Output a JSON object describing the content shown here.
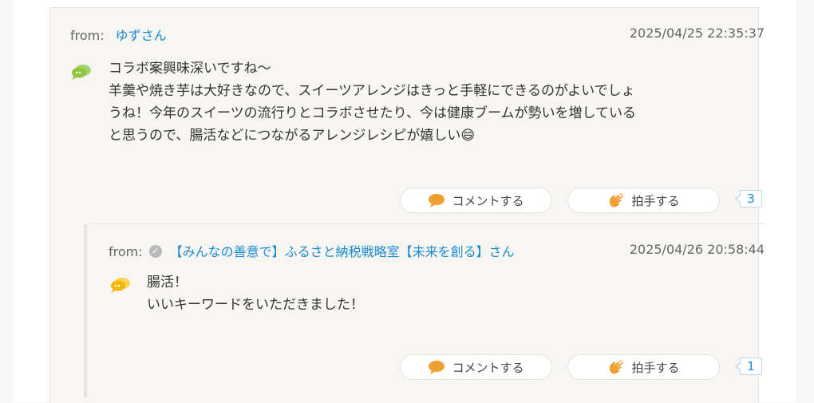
{
  "comment": {
    "from_label": "from:",
    "user": "ゆずさん",
    "date": "2025/04/25 22:35:37",
    "text": "コラボ案興味深いですね〜\n羊羹や焼き芋は大好きなので、スイーツアレンジはきっと手軽にできるのがよいでしょ\nうね！今年のスイーツの流行りとコラボさせたり、今は健康ブームが勢いを増している\nと思うので、腸活などにつながるアレンジレシピが嬉しい😄",
    "comment_btn": "コメントする",
    "clap_btn": "拍手する",
    "clap_count": "3",
    "icon": "speech-bubble-icon",
    "icon_color": "#8dc63f"
  },
  "reply": {
    "from_label": "from:",
    "user": "【みんなの善意で】ふるさと納税戦略室【未来を創る】さん",
    "date": "2025/04/26 20:58:44",
    "text": "腸活！\nいいキーワードをいただきました！",
    "comment_btn": "コメントする",
    "clap_btn": "拍手する",
    "clap_count": "1",
    "icon": "speech-bubble-icon",
    "icon_color": "#f5b800"
  },
  "colors": {
    "link": "#1a8ad2",
    "comment_icon": "#f0a030",
    "clap_icon": "#f0a030"
  }
}
